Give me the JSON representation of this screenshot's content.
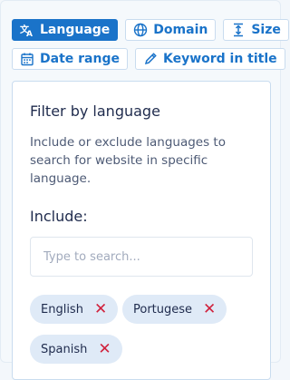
{
  "filter_tabs": [
    {
      "label": "Language",
      "icon": "translate-icon",
      "active": true
    },
    {
      "label": "Domain",
      "icon": "globe-icon",
      "active": false
    },
    {
      "label": "Size",
      "icon": "size-icon",
      "active": false
    },
    {
      "label": "Date range",
      "icon": "calendar-icon",
      "active": false
    },
    {
      "label": "Keyword in title",
      "icon": "pencil-icon",
      "active": false
    }
  ],
  "panel": {
    "title": "Filter by language",
    "description": "Include or exclude languages to search for website in specific language.",
    "include_label": "Include:",
    "search_placeholder": "Type to search...",
    "search_value": "",
    "selected_languages": [
      "English",
      "Portugese",
      "Spanish"
    ],
    "remove_symbol": "✕"
  },
  "colors": {
    "accent": "#1a73c9",
    "remove": "#d0213c",
    "tag_bg": "#dfeaf7"
  }
}
